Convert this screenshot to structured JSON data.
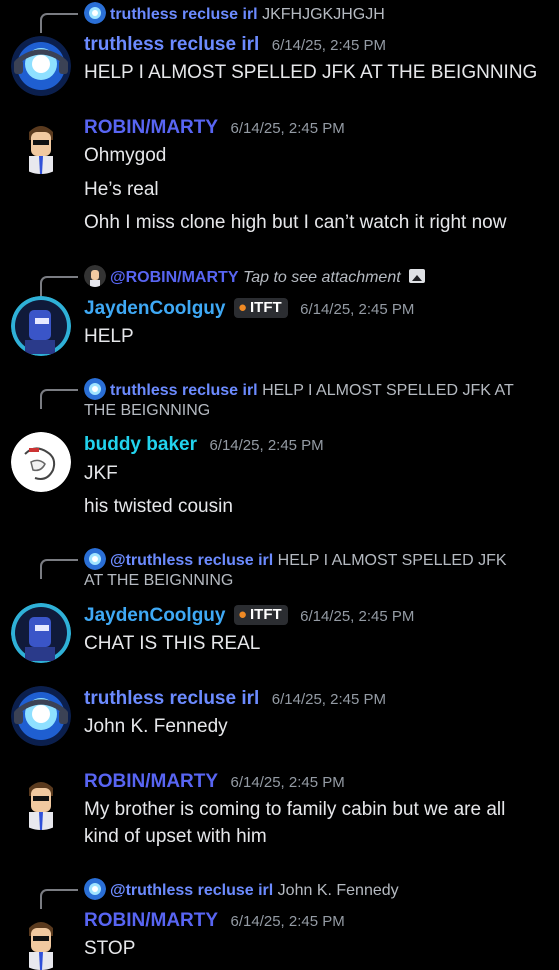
{
  "messages": [
    {
      "reply": {
        "name": "truthless recluse irl",
        "text": "JKFHJGKJHGJH"
      },
      "author": "truthless recluse irl",
      "time": "6/14/25, 2:45 PM",
      "lines": [
        "HELP I ALMOST SPELLED JFK AT THE BEIGNNING"
      ]
    },
    {
      "author": "ROBIN/MARTY",
      "time": "6/14/25, 2:45 PM",
      "lines": [
        "Ohmygod",
        "He’s real",
        "Ohh I miss clone high but I can’t watch it right now"
      ]
    },
    {
      "reply": {
        "name": "@ROBIN/MARTY",
        "text": "Tap to see attachment"
      },
      "author": "JaydenCoolguy",
      "tag": "ITFT",
      "time": "6/14/25, 2:45 PM",
      "lines": [
        "HELP"
      ]
    },
    {
      "reply": {
        "name": "truthless recluse irl",
        "text": "HELP I ALMOST SPELLED JFK AT",
        "text2": "THE BEIGNNING"
      },
      "author": "buddy baker",
      "time": "6/14/25, 2:45 PM",
      "lines": [
        "JKF",
        "his twisted cousin"
      ]
    },
    {
      "reply": {
        "name": "@truthless recluse irl",
        "text": "HELP I ALMOST SPELLED JFK",
        "text2": "AT THE BEIGNNING"
      },
      "author": "JaydenCoolguy",
      "tag": "ITFT",
      "time": "6/14/25, 2:45 PM",
      "lines": [
        "CHAT IS THIS REAL"
      ]
    },
    {
      "author": "truthless recluse irl",
      "time": "6/14/25, 2:45 PM",
      "lines": [
        "John K. Fennedy"
      ]
    },
    {
      "author": "ROBIN/MARTY",
      "time": "6/14/25, 2:45 PM",
      "lines": [
        "My brother is coming to family cabin but we are all",
        "kind of upset with him"
      ]
    },
    {
      "reply": {
        "name": "@truthless recluse irl",
        "text": "John K. Fennedy"
      },
      "author": "ROBIN/MARTY",
      "time": "6/14/25, 2:45 PM",
      "lines": [
        "STOP"
      ]
    }
  ],
  "colors": {
    "background": "#000000",
    "truthless": "#6c8bff",
    "robin": "#5865f2",
    "jayden": "#3fa9f5",
    "buddy": "#22d3ee",
    "timestamp": "#949ba4"
  },
  "icons": {
    "attachment": "image-icon",
    "badge": "flame-icon"
  }
}
